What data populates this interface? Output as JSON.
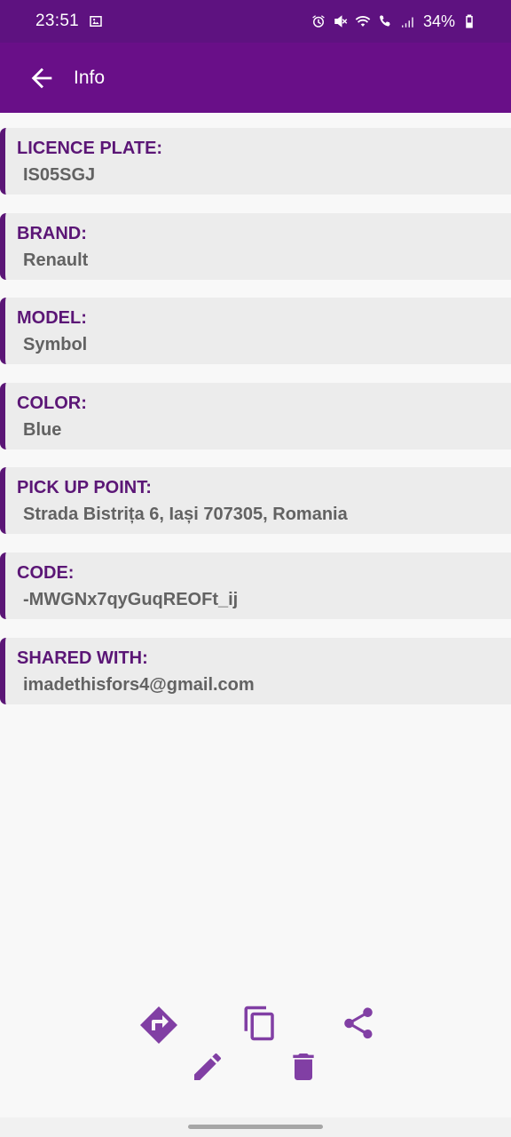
{
  "status_bar": {
    "time": "23:51",
    "battery": "34%",
    "icons": [
      "image-icon",
      "alarm-icon",
      "mute-icon",
      "wifi-icon",
      "wifi-calling-icon",
      "signal-icon",
      "battery-icon"
    ]
  },
  "app_bar": {
    "title": "Info",
    "back_icon": "arrow-back-icon"
  },
  "fields": [
    {
      "label": "LICENCE PLATE:",
      "value": "IS05SGJ"
    },
    {
      "label": "BRAND:",
      "value": "Renault"
    },
    {
      "label": "MODEL:",
      "value": "Symbol"
    },
    {
      "label": "COLOR:",
      "value": "Blue"
    },
    {
      "label": "PICK UP POINT:",
      "value": "Strada Bistrița 6, Iași 707305, Romania"
    },
    {
      "label": "CODE:",
      "value": "-MWGNx7qyGuqREOFt_ij"
    },
    {
      "label": "SHARED WITH:",
      "value": "imadethisfors4@gmail.com"
    }
  ],
  "actions": {
    "icons": [
      "directions-icon",
      "copy-icon",
      "share-icon",
      "edit-icon",
      "delete-icon"
    ],
    "color": "#813fa4"
  },
  "colors": {
    "status_bar": "#5e1280",
    "app_bar": "#690f88",
    "label": "#5b1676",
    "value": "#626262",
    "card": "#ececec"
  }
}
